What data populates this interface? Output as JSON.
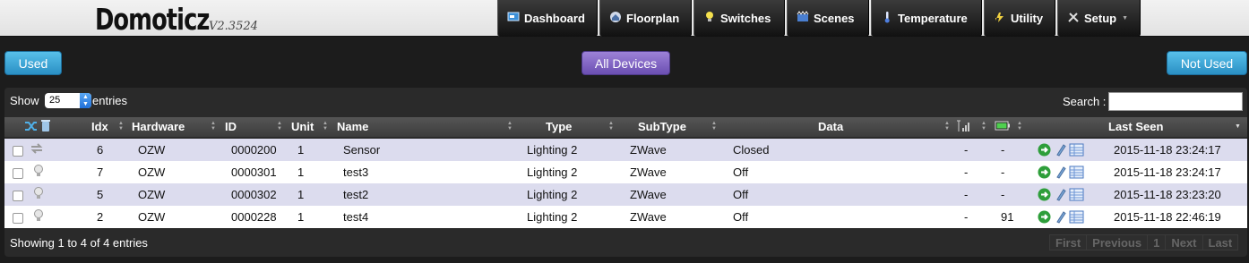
{
  "app": {
    "title": "Domoticz",
    "version": "V2.3524"
  },
  "nav": {
    "tabs": [
      {
        "label": "Dashboard",
        "icon": "dashboard-icon"
      },
      {
        "label": "Floorplan",
        "icon": "floorplan-icon"
      },
      {
        "label": "Switches",
        "icon": "lightbulb-icon"
      },
      {
        "label": "Scenes",
        "icon": "scenes-icon"
      },
      {
        "label": "Temperature",
        "icon": "thermometer-icon"
      },
      {
        "label": "Utility",
        "icon": "utility-icon"
      },
      {
        "label": "Setup",
        "icon": "tools-icon",
        "has_dropdown": true
      }
    ]
  },
  "filters": {
    "used": "Used",
    "all_devices": "All Devices",
    "not_used": "Not Used"
  },
  "table_controls": {
    "show_label": "Show",
    "page_length": "25",
    "entries_label": "entries",
    "search_label": "Search :",
    "search_value": ""
  },
  "table": {
    "columns": [
      "Idx",
      "Hardware",
      "ID",
      "Unit",
      "Name",
      "Type",
      "SubType",
      "Data",
      "",
      "",
      "Last Seen"
    ],
    "rows": [
      {
        "icon": "arrows-icon",
        "idx": "6",
        "hardware": "OZW",
        "id": "0000200",
        "unit": "1",
        "name": "Sensor",
        "type": "Lighting 2",
        "subtype": "ZWave",
        "data": "Closed",
        "signal": "-",
        "battery": "-",
        "last_seen": "2015-11-18 23:24:17"
      },
      {
        "icon": "lightbulb-icon",
        "idx": "7",
        "hardware": "OZW",
        "id": "0000301",
        "unit": "1",
        "name": "test3",
        "type": "Lighting 2",
        "subtype": "ZWave",
        "data": "Off",
        "signal": "-",
        "battery": "-",
        "last_seen": "2015-11-18 23:24:17"
      },
      {
        "icon": "lightbulb-icon",
        "idx": "5",
        "hardware": "OZW",
        "id": "0000302",
        "unit": "1",
        "name": "test2",
        "type": "Lighting 2",
        "subtype": "ZWave",
        "data": "Off",
        "signal": "-",
        "battery": "-",
        "last_seen": "2015-11-18 23:23:20"
      },
      {
        "icon": "lightbulb-icon",
        "idx": "2",
        "hardware": "OZW",
        "id": "0000228",
        "unit": "1",
        "name": "test4",
        "type": "Lighting 2",
        "subtype": "ZWave",
        "data": "Off",
        "signal": "-",
        "battery": "91",
        "last_seen": "2015-11-18 22:46:19"
      }
    ]
  },
  "footer": {
    "info": "Showing 1 to 4 of 4 entries",
    "pager": [
      "First",
      "Previous",
      "1",
      "Next",
      "Last"
    ]
  },
  "colors": {
    "used_button": "#3aa6da",
    "all_devices_button": "#8367c7",
    "odd_row": "#dcdcee"
  }
}
